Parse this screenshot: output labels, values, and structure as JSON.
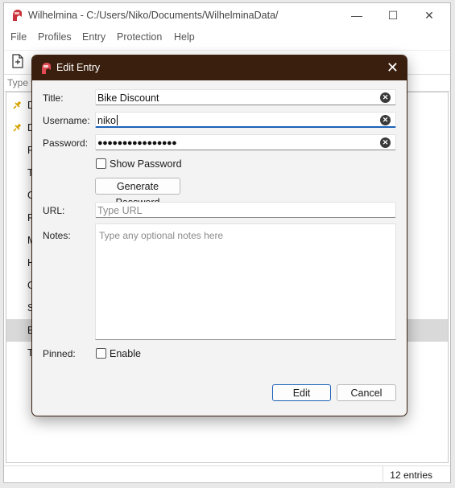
{
  "window": {
    "title": "Wilhelmina - C:/Users/Niko/Documents/WilhelminaData/",
    "minimize": "—",
    "maximize": "☐",
    "close": "✕"
  },
  "menu": [
    "File",
    "Profiles",
    "Entry",
    "Protection",
    "Help"
  ],
  "search": {
    "placeholder": "Type t"
  },
  "list": {
    "items": [
      "D",
      "D",
      "R",
      "T",
      "G",
      "F",
      "M",
      "H",
      "G",
      "S",
      "B",
      "T"
    ],
    "pinned": [
      true,
      true,
      false,
      false,
      false,
      false,
      false,
      false,
      false,
      false,
      false,
      false
    ],
    "selected_index": 10
  },
  "status": {
    "entries": "12 entries"
  },
  "dialog": {
    "title": "Edit Entry",
    "close": "✕",
    "title_label": "Title:",
    "title_value": "Bike Discount",
    "username_label": "Username:",
    "username_value": "niko",
    "password_label": "Password:",
    "password_value": "●●●●●●●●●●●●●●●●",
    "show_password": "Show Password",
    "generate_password": "Generate Password",
    "url_label": "URL:",
    "url_placeholder": "Type URL",
    "notes_label": "Notes:",
    "notes_placeholder": "Type any optional notes here",
    "pinned_label": "Pinned:",
    "enable": "Enable",
    "edit_button": "Edit",
    "cancel_button": "Cancel",
    "clear_glyph": "✕"
  },
  "colors": {
    "dialog_title_bg": "#3a1f0e",
    "accent": "#1a62b8",
    "selected_row": "#d9d9d9"
  }
}
